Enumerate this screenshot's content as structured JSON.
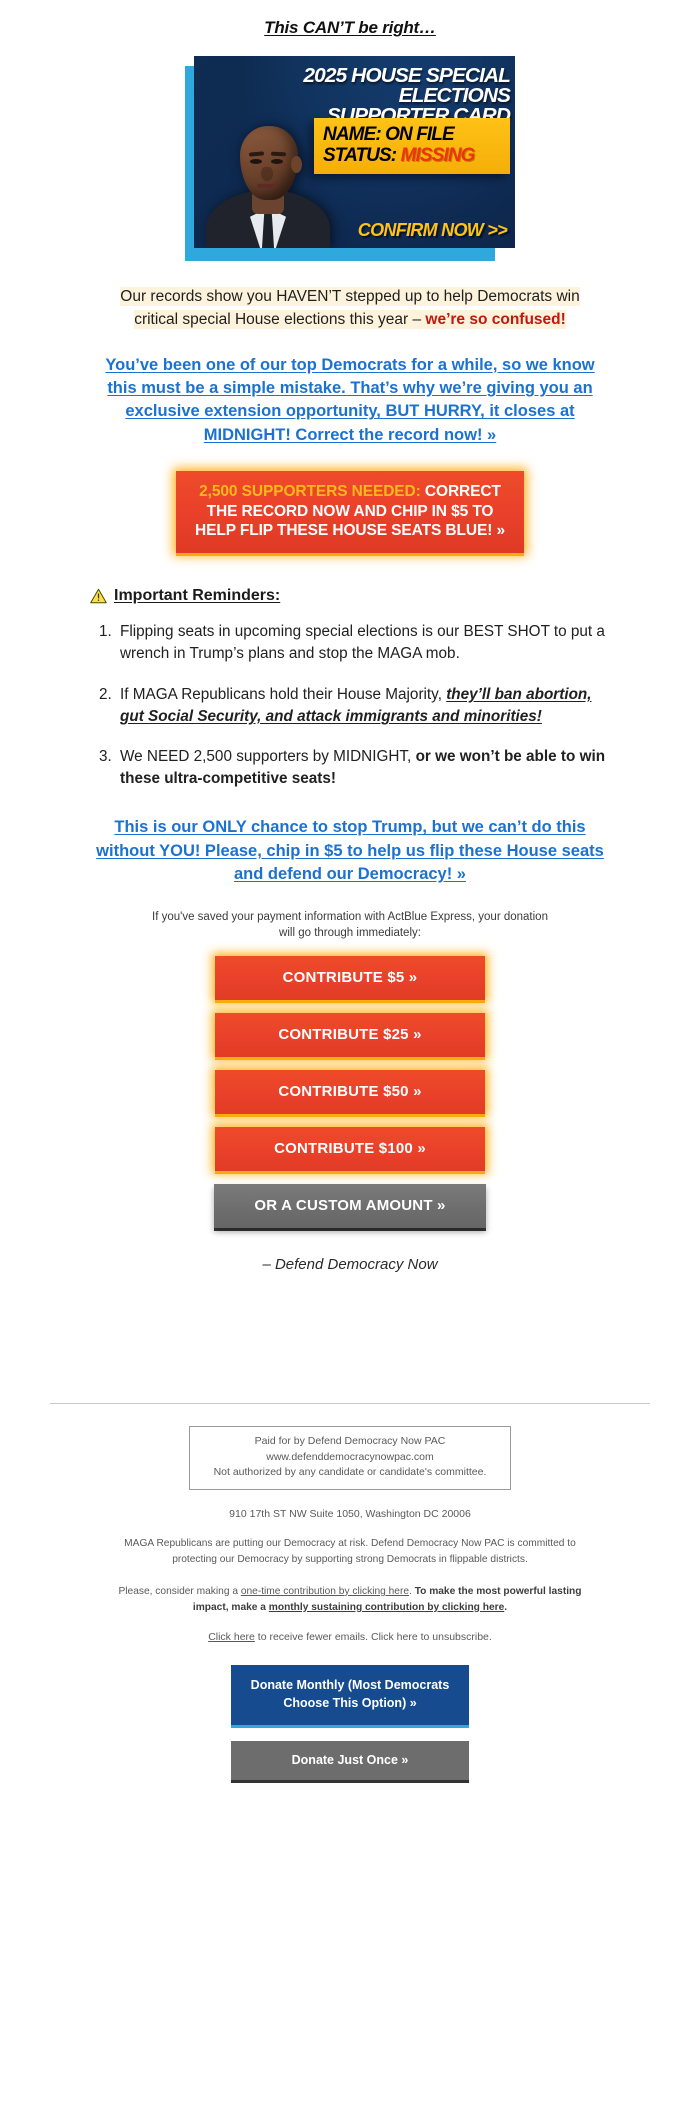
{
  "headline": "This CAN’T be right…",
  "hero_card": {
    "title_line1": "2025 HOUSE SPECIAL ELECTIONS",
    "title_line2": "SUPPORTER CARD",
    "name_row": "NAME: ON FILE",
    "status_label": "STATUS:",
    "status_value": "MISSING",
    "cta": "CONFIRM NOW >>",
    "colors": {
      "card_blue": "#2fa8dd",
      "panel_yellow": "#ffc216",
      "status_red": "#f0330b"
    }
  },
  "intro": {
    "line1": "Our records show you HAVEN’T stepped up to help Democrats win",
    "line2_plain": "critical special House elections this year – ",
    "line2_bold": "we’re so confused!",
    "highlight_color": "#fdf3dc"
  },
  "link_primary": "You’ve been one of our top Democrats for a while, so we know this must be a simple mistake. That’s why we’re giving you an exclusive extension opportunity, BUT HURRY, it closes at MIDNIGHT! Correct the record now! »",
  "cta_banner": {
    "amount_text": "2,500 SUPPORTERS NEEDED:",
    "rest_text": " CORRECT THE RECORD NOW AND CHIP IN $5 TO HELP FLIP THESE HOUSE SEATS BLUE! »",
    "bg_color": "#e8402a",
    "accent_color": "#ffb81c",
    "glow_color": "#ffb014"
  },
  "reminders": {
    "icon": "warning-triangle-icon",
    "heading": "Important Reminders:",
    "items": [
      {
        "text_before": "Flipping seats in upcoming special elections is our BEST SHOT to put a wrench in Trump’s plans and stop the MAGA mob.",
        "text_emphasis": "",
        "text_after": ""
      },
      {
        "text_before": "If MAGA Republicans hold their House Majority, ",
        "text_emphasis": "they’ll ban abortion, gut Social Security, and attack immigrants and minorities!",
        "text_after": ""
      },
      {
        "text_before": "We NEED 2,500 supporters by MIDNIGHT, ",
        "text_emphasis": "or we won’t be able to win these ultra-competitive seats!",
        "text_after": ""
      }
    ]
  },
  "link_secondary": "This is our ONLY chance to stop Trump, but we can’t do this without YOU! Please, chip in $5 to help us flip these House seats and defend our Democracy! »",
  "express_note": {
    "line1": "If you've saved your payment information with ActBlue Express, your donation",
    "line2": "will go through immediately:"
  },
  "donate_buttons": [
    {
      "label": "CONTRIBUTE $5 »",
      "style": "red"
    },
    {
      "label": "CONTRIBUTE $25 »",
      "style": "red"
    },
    {
      "label": "CONTRIBUTE $50 »",
      "style": "red"
    },
    {
      "label": "CONTRIBUTE $100 »",
      "style": "red"
    },
    {
      "label": "OR A CUSTOM AMOUNT »",
      "style": "gray"
    }
  ],
  "signature": "– Defend Democracy Now",
  "footer": {
    "disclaimer_line1": "Paid for by Defend Democracy Now PAC",
    "disclaimer_line2": "www.defenddemocracynowpac.com",
    "disclaimer_line3": "Not authorized by any candidate or candidate's committee.",
    "address": "910 17th ST NW Suite 1050, Washington DC 20006",
    "mission": "MAGA Republicans are putting our Democracy at risk. Defend Democracy Now PAC is committed to protecting our Democracy by supporting strong Democrats in flippable districts.",
    "ask_plain1": "Please, consider making a ",
    "ask_link1": "one-time contribution by clicking here",
    "ask_plain2": ". ",
    "ask_bold_plain": "To make the most powerful lasting impact, make a ",
    "ask_bold_link": "monthly sustaining contribution by clicking here",
    "ask_bold_end": ".",
    "prefs_link": "Click here",
    "prefs_rest": " to receive fewer emails. Click here to unsubscribe.",
    "btn_monthly_line1": "Donate Monthly (Most Democrats",
    "btn_monthly_line2": "Choose This Option) »",
    "btn_once": "Donate Just Once »",
    "colors": {
      "monthly_blue": "#164c8f",
      "once_gray": "#6d6d6d"
    }
  }
}
